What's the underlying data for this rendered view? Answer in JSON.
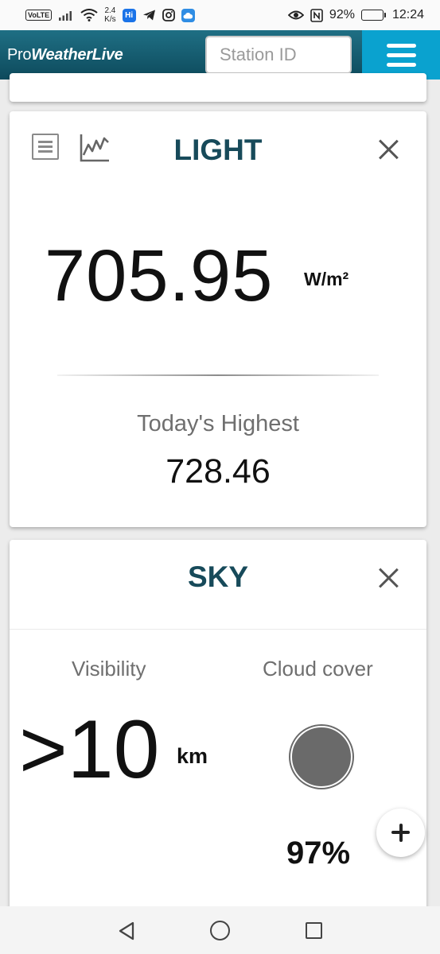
{
  "status_bar": {
    "volte": "VoLTE",
    "net_speed_value": "2.4",
    "net_speed_unit": "K/s",
    "hi_icon": "Hi",
    "battery_percent": "92%",
    "battery_level": 0.92,
    "time": "12:24",
    "icons": [
      "signal-icon",
      "wifi-icon",
      "telegram-icon",
      "instagram-icon",
      "cloud-icon",
      "eye-icon",
      "nfc-icon",
      "battery-icon"
    ]
  },
  "header": {
    "logo_prefix": "Pro",
    "logo_suffix": "WeatherLive",
    "station_placeholder": "Station ID",
    "menu_icon": "hamburger-icon",
    "bar_color": "#0d4a5c",
    "accent_color": "#0aa2cf"
  },
  "light_card": {
    "title": "LIGHT",
    "value": "705.95",
    "unit": "W/m²",
    "highest_label": "Today's Highest",
    "highest_value": "728.46",
    "title_color": "#174a5a"
  },
  "sky_card": {
    "title": "SKY",
    "visibility_label": "Visibility",
    "visibility_value": ">10",
    "visibility_unit": "km",
    "cloud_label": "Cloud cover",
    "cloud_value": "97%",
    "cloud_fraction": 0.97
  },
  "fab": {
    "icon": "plus-icon"
  },
  "nav": {
    "icons": [
      "back-icon",
      "home-icon",
      "recents-icon"
    ]
  }
}
